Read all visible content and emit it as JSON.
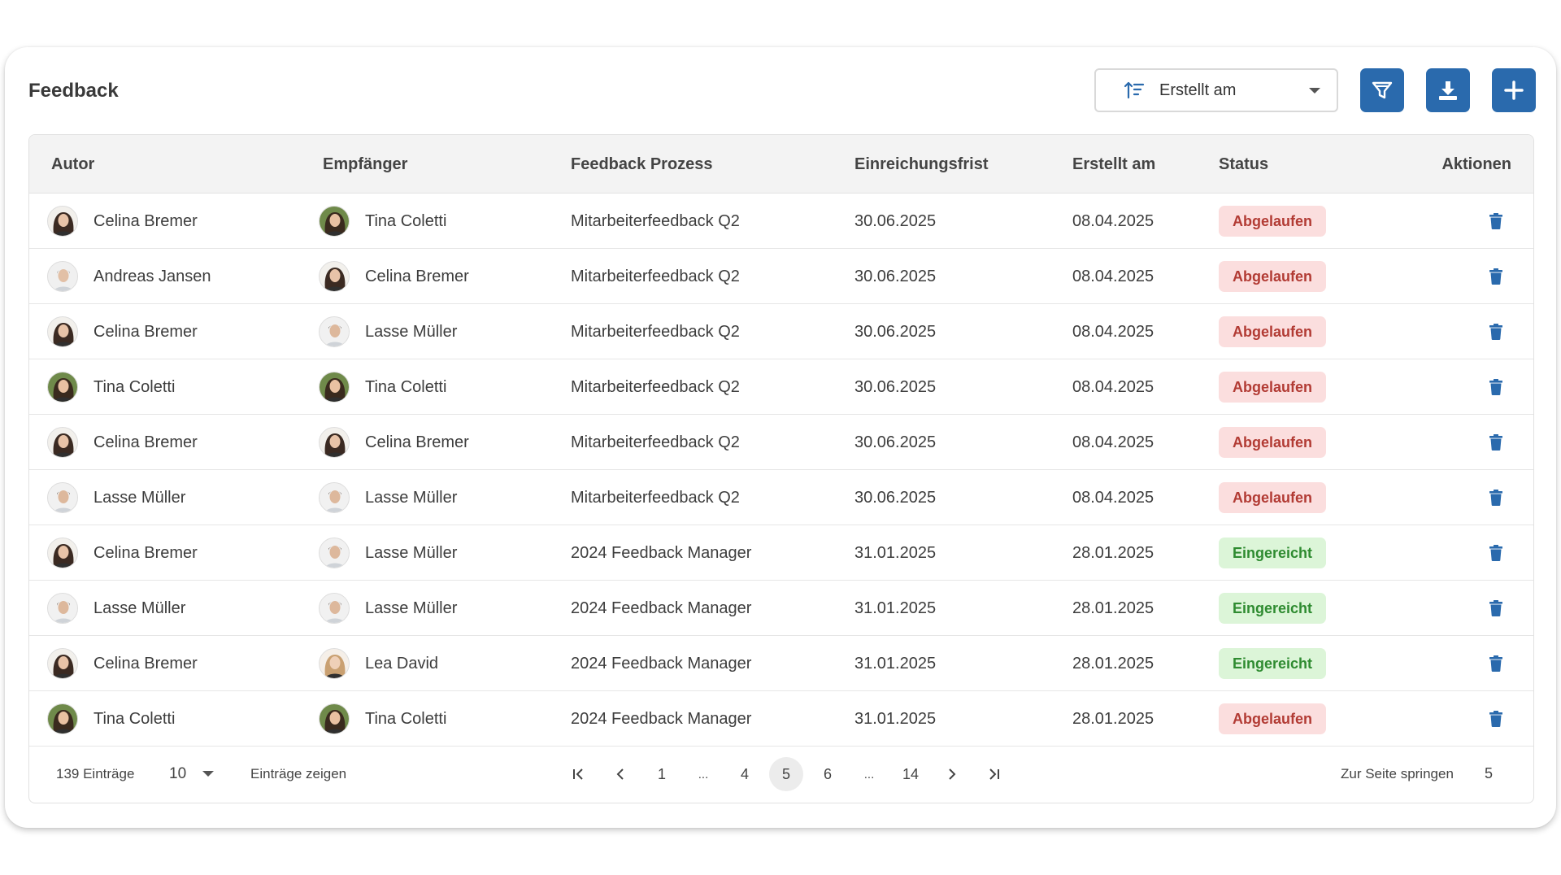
{
  "header": {
    "title": "Feedback",
    "sort_label": "Erstellt am"
  },
  "toolbar": {
    "filter_icon": "filter-icon",
    "download_icon": "download-icon",
    "add_icon": "plus-icon",
    "accent_color": "#2a6aad"
  },
  "table": {
    "columns": [
      "Autor",
      "Empfänger",
      "Feedback Prozess",
      "Einreichungsfrist",
      "Erstellt am",
      "Status",
      "Aktionen"
    ],
    "rows": [
      {
        "author": "Celina Bremer",
        "author_avatar": "celina",
        "recipient": "Tina Coletti",
        "recipient_avatar": "tina",
        "process": "Mitarbeiterfeedback Q2",
        "deadline": "30.06.2025",
        "created": "08.04.2025",
        "status": "Abgelaufen",
        "status_type": "red"
      },
      {
        "author": "Andreas Jansen",
        "author_avatar": "andreas",
        "recipient": "Celina Bremer",
        "recipient_avatar": "celina",
        "process": "Mitarbeiterfeedback Q2",
        "deadline": "30.06.2025",
        "created": "08.04.2025",
        "status": "Abgelaufen",
        "status_type": "red"
      },
      {
        "author": "Celina Bremer",
        "author_avatar": "celina",
        "recipient": "Lasse Müller",
        "recipient_avatar": "lasse",
        "process": "Mitarbeiterfeedback Q2",
        "deadline": "30.06.2025",
        "created": "08.04.2025",
        "status": "Abgelaufen",
        "status_type": "red"
      },
      {
        "author": "Tina Coletti",
        "author_avatar": "tina",
        "recipient": "Tina Coletti",
        "recipient_avatar": "tina",
        "process": "Mitarbeiterfeedback Q2",
        "deadline": "30.06.2025",
        "created": "08.04.2025",
        "status": "Abgelaufen",
        "status_type": "red"
      },
      {
        "author": "Celina Bremer",
        "author_avatar": "celina",
        "recipient": "Celina Bremer",
        "recipient_avatar": "celina",
        "process": "Mitarbeiterfeedback Q2",
        "deadline": "30.06.2025",
        "created": "08.04.2025",
        "status": "Abgelaufen",
        "status_type": "red"
      },
      {
        "author": "Lasse Müller",
        "author_avatar": "lasse",
        "recipient": "Lasse Müller",
        "recipient_avatar": "lasse",
        "process": "Mitarbeiterfeedback Q2",
        "deadline": "30.06.2025",
        "created": "08.04.2025",
        "status": "Abgelaufen",
        "status_type": "red"
      },
      {
        "author": "Celina Bremer",
        "author_avatar": "celina",
        "recipient": "Lasse Müller",
        "recipient_avatar": "lasse",
        "process": "2024 Feedback Manager",
        "deadline": "31.01.2025",
        "created": "28.01.2025",
        "status": "Eingereicht",
        "status_type": "green"
      },
      {
        "author": "Lasse Müller",
        "author_avatar": "lasse",
        "recipient": "Lasse Müller",
        "recipient_avatar": "lasse",
        "process": "2024 Feedback Manager",
        "deadline": "31.01.2025",
        "created": "28.01.2025",
        "status": "Eingereicht",
        "status_type": "green"
      },
      {
        "author": "Celina Bremer",
        "author_avatar": "celina",
        "recipient": "Lea David",
        "recipient_avatar": "lea",
        "process": "2024 Feedback Manager",
        "deadline": "31.01.2025",
        "created": "28.01.2025",
        "status": "Eingereicht",
        "status_type": "green"
      },
      {
        "author": "Tina Coletti",
        "author_avatar": "tina",
        "recipient": "Tina Coletti",
        "recipient_avatar": "tina",
        "process": "2024 Feedback Manager",
        "deadline": "31.01.2025",
        "created": "28.01.2025",
        "status": "Abgelaufen",
        "status_type": "red"
      }
    ]
  },
  "footer": {
    "total": "139 Einträge",
    "page_size": "10",
    "page_size_label": "Einträge zeigen",
    "pages": [
      "1",
      "...",
      "4",
      "5",
      "6",
      "...",
      "14"
    ],
    "current_page": "5",
    "jump_label": "Zur Seite springen",
    "jump_value": "5"
  },
  "colors": {
    "red_badge_bg": "#fbdede",
    "red_badge_text": "#b23b34",
    "green_badge_bg": "#dcf5d8",
    "green_badge_text": "#2e8b30",
    "trash": "#2a6aad"
  }
}
